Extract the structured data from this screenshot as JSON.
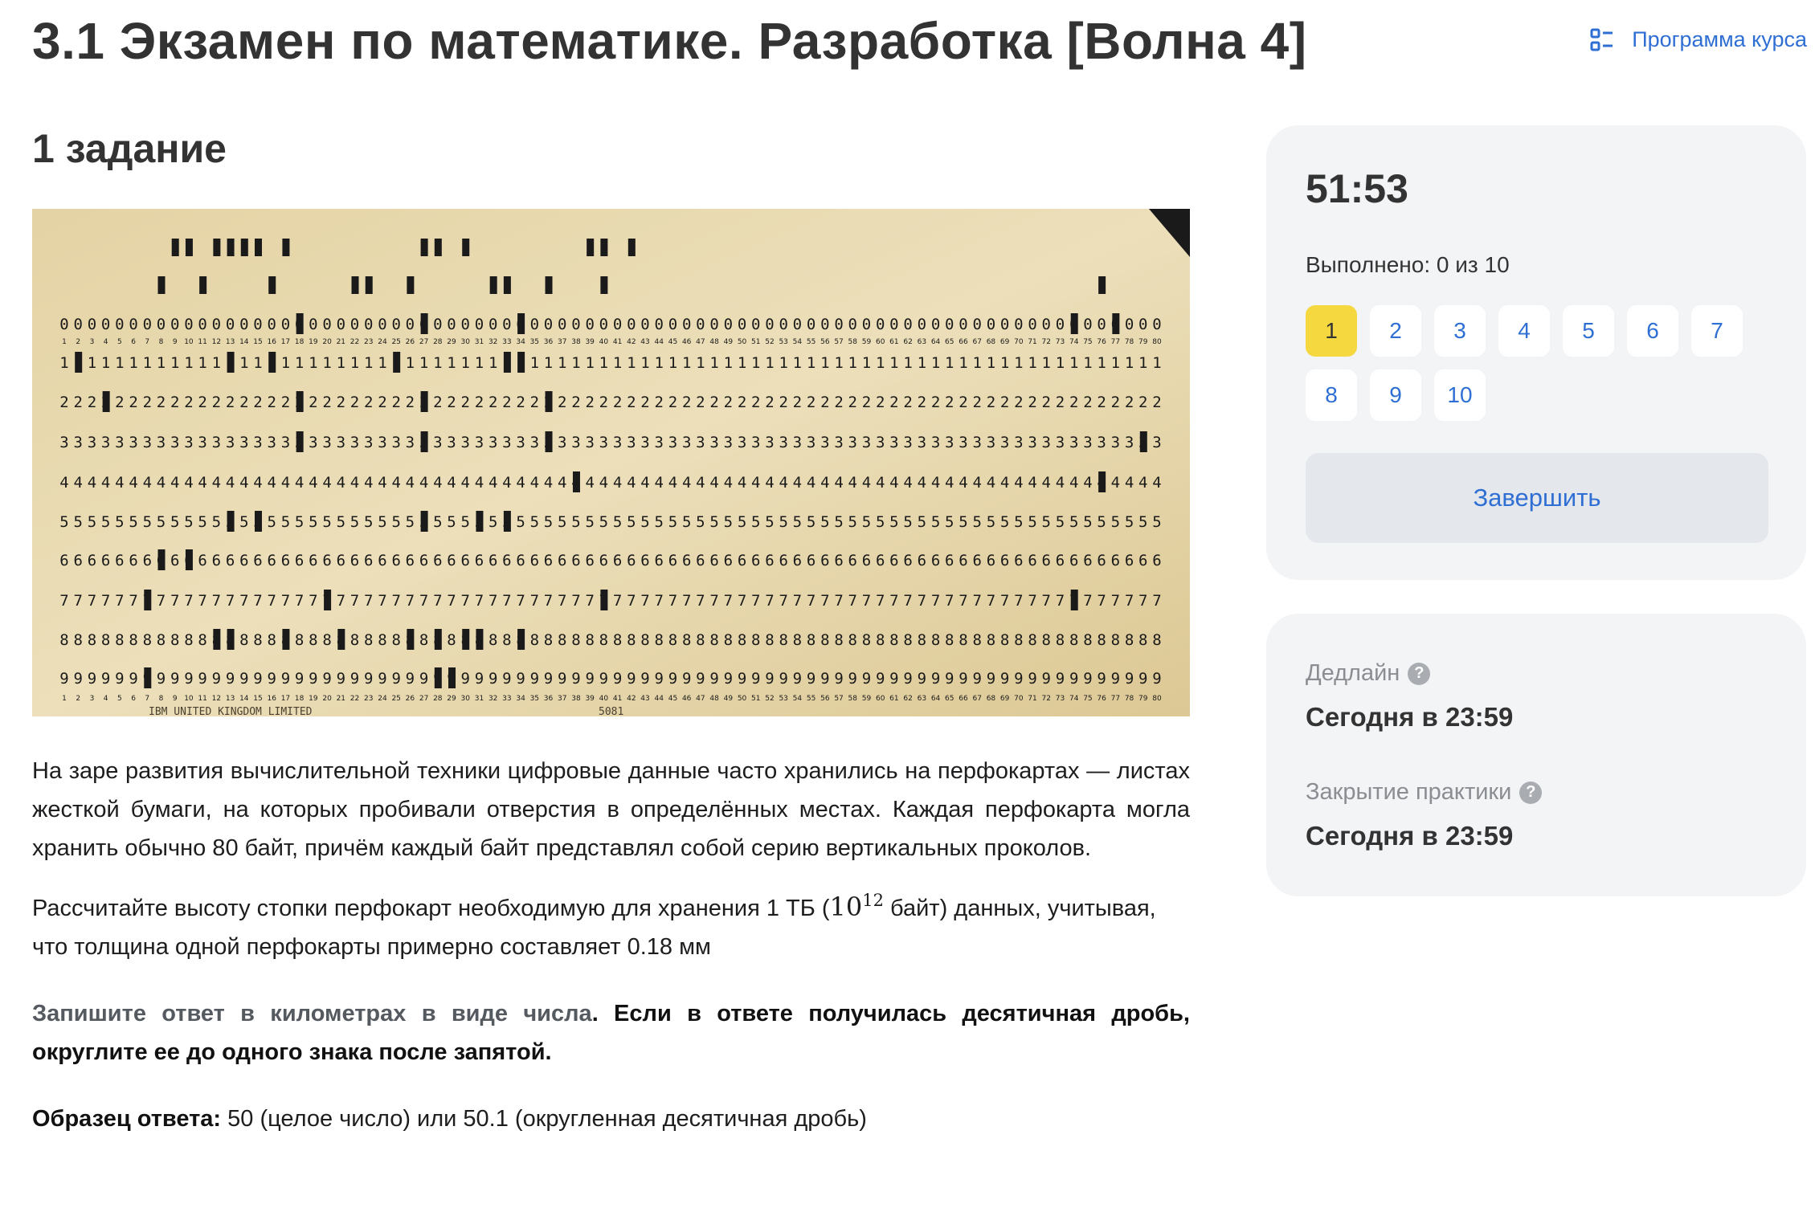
{
  "header": {
    "title": "3.1 Экзамен по математике. Разработка [Волна 4]",
    "program_link_label": "Программа курса",
    "program_icon": "list-icon"
  },
  "task": {
    "title": "1 задание",
    "paragraph1": "На заре развития вычислительной техники цифровые данные часто хранились на перфокартах — листах жесткой бумаги, на которых пробивали отверстия в определённых местах. Каждая перфокарта могла хранить обычно 80 байт, причём каждый байт представлял собой серию вертикальных проколов.",
    "paragraph2_before": "Рассчитайте высоту стопки перфокарт необходимую для хранения 1 ТБ (",
    "paragraph2_math_base": "10",
    "paragraph2_math_exp": "12",
    "paragraph2_after": " байт) данных, учитывая, что толщина одной перфокарты примерно составляет 0.18 мм",
    "paragraph3_muted": "Запишите ответ в километрах в виде числа",
    "paragraph3_bold": ". Если в ответе получилась десятичная дробь, округлите ее до одного знака после запятой.",
    "example_label": "Образец ответа:",
    "example_text": " 50 (целое число) или 50.1 (округленная десятичная дробь)"
  },
  "punch_card": {
    "digit_rows": [
      "0",
      "1",
      "2",
      "3",
      "4",
      "5",
      "6",
      "7",
      "8",
      "9"
    ],
    "bottom_text_left": "IBM  UNITED  KINGDOM  LIMITED",
    "bottom_text_right": "5081",
    "paper_color": "#e8d9b0",
    "ink_color": "#1a1a1a"
  },
  "sidebar": {
    "timer": "51:53",
    "progress": "Выполнено: 0 из 10",
    "questions": [
      "1",
      "2",
      "3",
      "4",
      "5",
      "6",
      "7",
      "8",
      "9",
      "10"
    ],
    "active_question": "1",
    "finish_label": "Завершить",
    "deadline_label": "Дедлайн",
    "deadline_value": "Сегодня в 23:59",
    "closing_label": "Закрытие практики",
    "closing_value": "Сегодня в 23:59",
    "help_icon": "?"
  },
  "colors": {
    "accent": "#2f6fd4",
    "active": "#f5d83f",
    "panel": "#f3f4f6"
  }
}
